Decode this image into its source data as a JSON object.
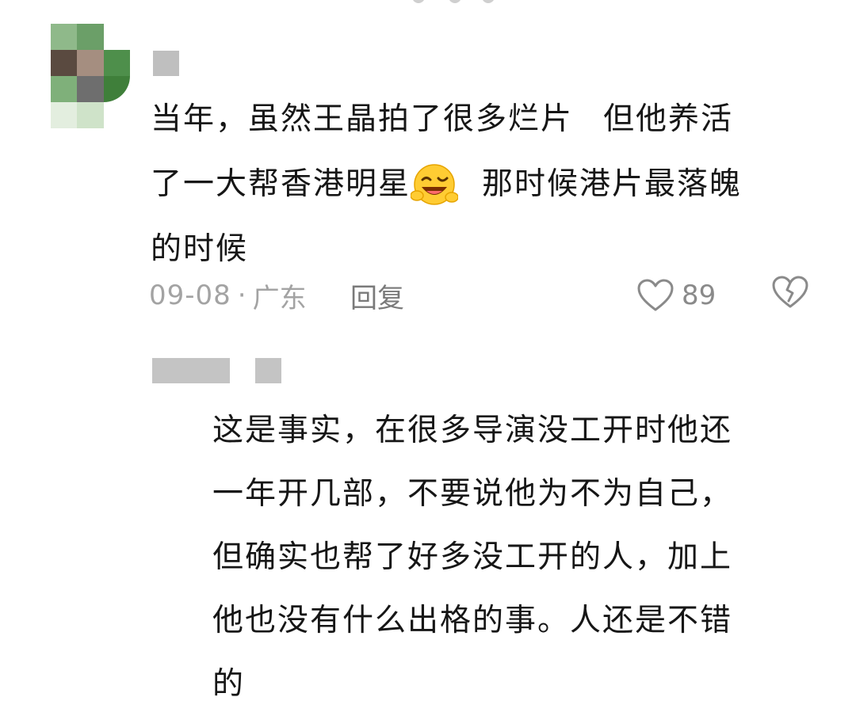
{
  "comment": {
    "text_lines": [
      {
        "parts": [
          "当年，虽然王晶拍了很多烂片",
          "但他养活"
        ]
      },
      {
        "parts": [
          "了一大帮香港明星",
          "那时候港片最落魄"
        ],
        "emoji": "grinning-winking-face"
      },
      {
        "parts": [
          "的时候"
        ]
      }
    ],
    "date": "09-08",
    "separator": "·",
    "location": "广东",
    "reply_label": "回复",
    "like_count": "89",
    "icons": {
      "like": "heart-outline-icon",
      "dislike": "broken-heart-icon"
    }
  },
  "reply": {
    "text_lines": [
      "这是事实，在很多导演没工开时他还",
      "一年开几部，不要说他为不为自己，",
      "但确实也帮了好多没工开的人，加上",
      "他也没有什么出格的事。人还是不错",
      "的"
    ]
  },
  "colors": {
    "text": "#161616",
    "meta": "#a3a3a3",
    "icon": "#8a8a8a",
    "masked_name": "#c4c4c4"
  }
}
